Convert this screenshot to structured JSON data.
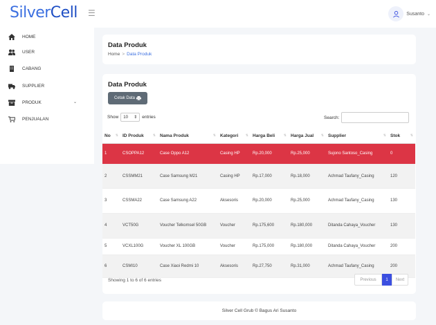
{
  "app": {
    "logo_part1": "Silver",
    "logo_part2": "Cell",
    "user_name": "Susanto"
  },
  "sidebar": {
    "items": [
      {
        "label": "HOME",
        "icon": "home-icon"
      },
      {
        "label": "USER",
        "icon": "users-icon"
      },
      {
        "label": "CABANG",
        "icon": "building-icon"
      },
      {
        "label": "SUPPLIER",
        "icon": "truck-icon"
      },
      {
        "label": "PRODUK",
        "icon": "box-icon"
      },
      {
        "label": "PENJUALAN",
        "icon": "cart-icon"
      }
    ]
  },
  "header": {
    "title": "Data Produk",
    "breadcrumb_home": "Home",
    "breadcrumb_sep": ">",
    "breadcrumb_current": "Data Produk"
  },
  "main": {
    "title": "Data Produk",
    "print_label": "Cetak Data",
    "show_label": "Show",
    "entries_value": "10",
    "entries_label": "entries",
    "search_label": "Search:",
    "columns": [
      "No",
      "ID Produk",
      "Nama Produk",
      "Kategori",
      "Harga Beli",
      "Harga Jual",
      "Supplier",
      "Stok"
    ],
    "rows": [
      [
        "1",
        "CSOPPA12",
        "Case Oppo A12",
        "Casing HP",
        "Rp.20,000",
        "Rp.25,000",
        "Sujono Santoso_Casing",
        "0"
      ],
      [
        "2",
        "CSSMM21",
        "Case Samsung M21",
        "Casing HP",
        "Rp.17,000",
        "Rp.18,000",
        "Achmad Taufany_Casing",
        "120"
      ],
      [
        "3",
        "CSSMA22",
        "Case Samsung A22",
        "Aksesoris",
        "Rp.20,000",
        "Rp.25,000",
        "Achmad Taufany_Casing",
        "130"
      ],
      [
        "4",
        "VCT50G",
        "Voucher Telkomsel 50GB",
        "Voucher",
        "Rp.175,600",
        "Rp.180,000",
        "Ditanda Cahaya_Voucher",
        "130"
      ],
      [
        "5",
        "VCXL100G",
        "Voucher XL 100GB",
        "Voucher",
        "Rp.175,000",
        "Rp.180,000",
        "Ditanda Cahaya_Voucher",
        "200"
      ],
      [
        "6",
        "CSMI10",
        "Case Xiaoi Redmi 10",
        "Aksesoris",
        "Rp.27,750",
        "Rp.31,000",
        "Achmad Taufany_Casing",
        "200"
      ]
    ],
    "info": "Showing 1 to 6 of 6 entries",
    "prev_label": "Previous",
    "page_number": "1",
    "next_label": "Next"
  },
  "footer": {
    "text": "Silver Cell Grub © Bagus Ari Susanto"
  },
  "colors": {
    "primary": "#3b6fe0",
    "danger_row": "#dc3545",
    "print_button": "#5f6b76"
  }
}
